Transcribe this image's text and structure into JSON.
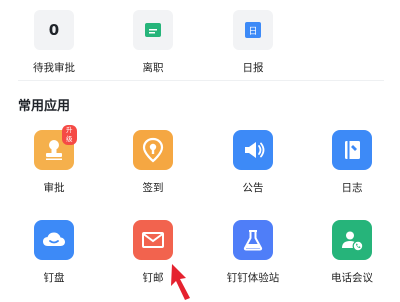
{
  "top_row": [
    {
      "value": "0",
      "label": "待我审批"
    },
    {
      "icon": "leave-icon",
      "label": "离职",
      "color": "#26b47a"
    },
    {
      "icon": "daily-report-icon",
      "glyph": "日",
      "label": "日报",
      "color": "#3d8af7"
    }
  ],
  "section": {
    "title": "常用应用"
  },
  "apps_row1": [
    {
      "icon": "stamp-icon",
      "label": "审批",
      "color": "#f5b04c",
      "badge": "升级"
    },
    {
      "icon": "location-pin-icon",
      "label": "签到",
      "color": "#f5a742"
    },
    {
      "icon": "megaphone-icon",
      "label": "公告",
      "color": "#3d8af7"
    },
    {
      "icon": "notebook-icon",
      "label": "日志",
      "color": "#3d8af7"
    }
  ],
  "apps_row2": [
    {
      "icon": "cloud-drive-icon",
      "label": "钉盘",
      "color": "#3d8af7"
    },
    {
      "icon": "mail-icon",
      "label": "钉邮",
      "color": "#f2634e"
    },
    {
      "icon": "flask-icon",
      "label": "钉钉体验站",
      "color": "#4f7ef8"
    },
    {
      "icon": "phone-contact-icon",
      "label": "电话会议",
      "color": "#26b47a"
    }
  ],
  "colors": {
    "arrow": "#e5222f"
  }
}
